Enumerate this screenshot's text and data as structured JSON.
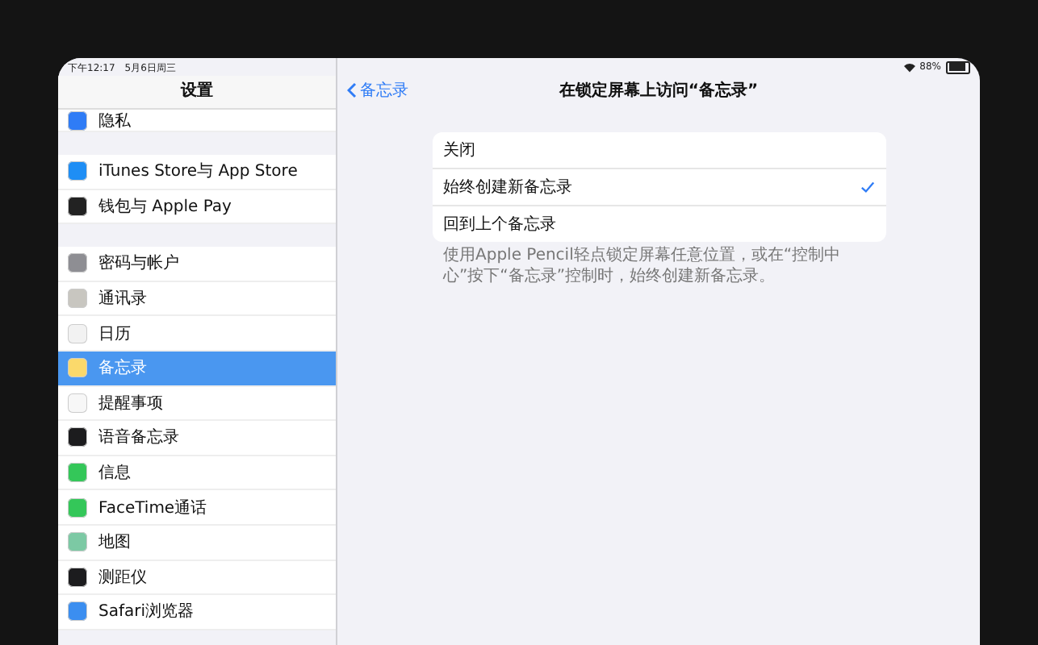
{
  "status_bar": {
    "time": "下午12:17",
    "date": "5月6日周三",
    "battery": "88%"
  },
  "sidebar": {
    "title": "设置",
    "groups": [
      [
        {
          "label": "隐私",
          "color": "#2f7cf6",
          "selected": false
        }
      ],
      [
        {
          "label": "iTunes Store与 App Store",
          "color": "#1e8ef5",
          "selected": false
        },
        {
          "label": "钱包与 Apple Pay",
          "color": "#222222",
          "selected": false
        }
      ],
      [
        {
          "label": "密码与帐户",
          "color": "#8e8e93",
          "selected": false
        },
        {
          "label": "通讯录",
          "color": "#c8c6c0",
          "selected": false
        },
        {
          "label": "日历",
          "color": "#f2f2f2",
          "selected": false
        },
        {
          "label": "备忘录",
          "color": "#fbd96b",
          "selected": true
        },
        {
          "label": "提醒事项",
          "color": "#f7f7f7",
          "selected": false
        },
        {
          "label": "语音备忘录",
          "color": "#1c1c1e",
          "selected": false
        },
        {
          "label": "信息",
          "color": "#34c759",
          "selected": false
        },
        {
          "label": "FaceTime通话",
          "color": "#34c759",
          "selected": false
        },
        {
          "label": "地图",
          "color": "#7cc9a4",
          "selected": false
        },
        {
          "label": "测距仪",
          "color": "#1c1c1e",
          "selected": false
        },
        {
          "label": "Safari浏览器",
          "color": "#3b8ef0",
          "selected": false
        }
      ]
    ]
  },
  "detail": {
    "back": "备忘录",
    "title": "在锁定屏幕上访问“备忘录”",
    "options": [
      {
        "label": "关闭",
        "selected": false
      },
      {
        "label": "始终创建新备忘录",
        "selected": true
      },
      {
        "label": "回到上个备忘录",
        "selected": false
      }
    ],
    "footer": "使用Apple Pencil轻点锁定屏幕任意位置，或在“控制中心”按下“备忘录”控制时，始终创建新备忘录。"
  }
}
